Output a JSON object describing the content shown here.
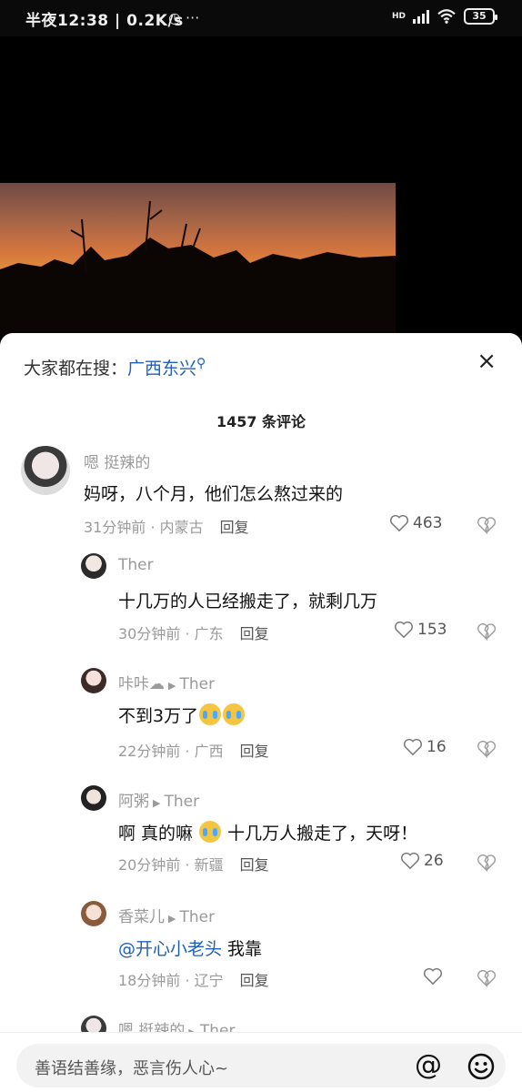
{
  "status_bar": {
    "time": "半夜12:38 | 0.2K/s",
    "extra_icons": "◷ ···",
    "network_type": "HD",
    "battery": "35"
  },
  "comments_panel": {
    "search_prefix": "大家都在搜：",
    "search_term": "广西东兴",
    "close_label": "×",
    "count_label": "1457 条评论",
    "comments": [
      {
        "user": "嗯 挺辣的",
        "reply_to": "",
        "text": "妈呀，八个月，他们怎么熬过来的",
        "time": "31分钟前",
        "location": "内蒙古",
        "reply_label": "回复",
        "likes": "463"
      },
      {
        "user": "Ther",
        "reply_to": "",
        "text": "十几万的人已经搬走了，就剩几万",
        "time": "30分钟前",
        "location": "广东",
        "reply_label": "回复",
        "likes": "153"
      },
      {
        "user": "咔咔",
        "reply_to": "Ther",
        "text": "不到3万了",
        "time": "22分钟前",
        "location": "广西",
        "reply_label": "回复",
        "likes": "16"
      },
      {
        "user": "阿粥",
        "reply_to": "Ther",
        "text_a": "啊  真的嘛",
        "text_b": " 十几万人搬走了，天呀！",
        "time": "20分钟前",
        "location": "新疆",
        "reply_label": "回复",
        "likes": "26"
      },
      {
        "user": "香菜儿",
        "reply_to": "Ther",
        "mention": "@开心小老头",
        "text": " 我靠",
        "time": "18分钟前",
        "location": "辽宁",
        "reply_label": "回复",
        "likes": ""
      },
      {
        "user": "嗯 挺辣的",
        "reply_to": "Ther"
      }
    ]
  },
  "input": {
    "placeholder": "善语结善缘，恶言伤人心~",
    "at_label": "@"
  }
}
